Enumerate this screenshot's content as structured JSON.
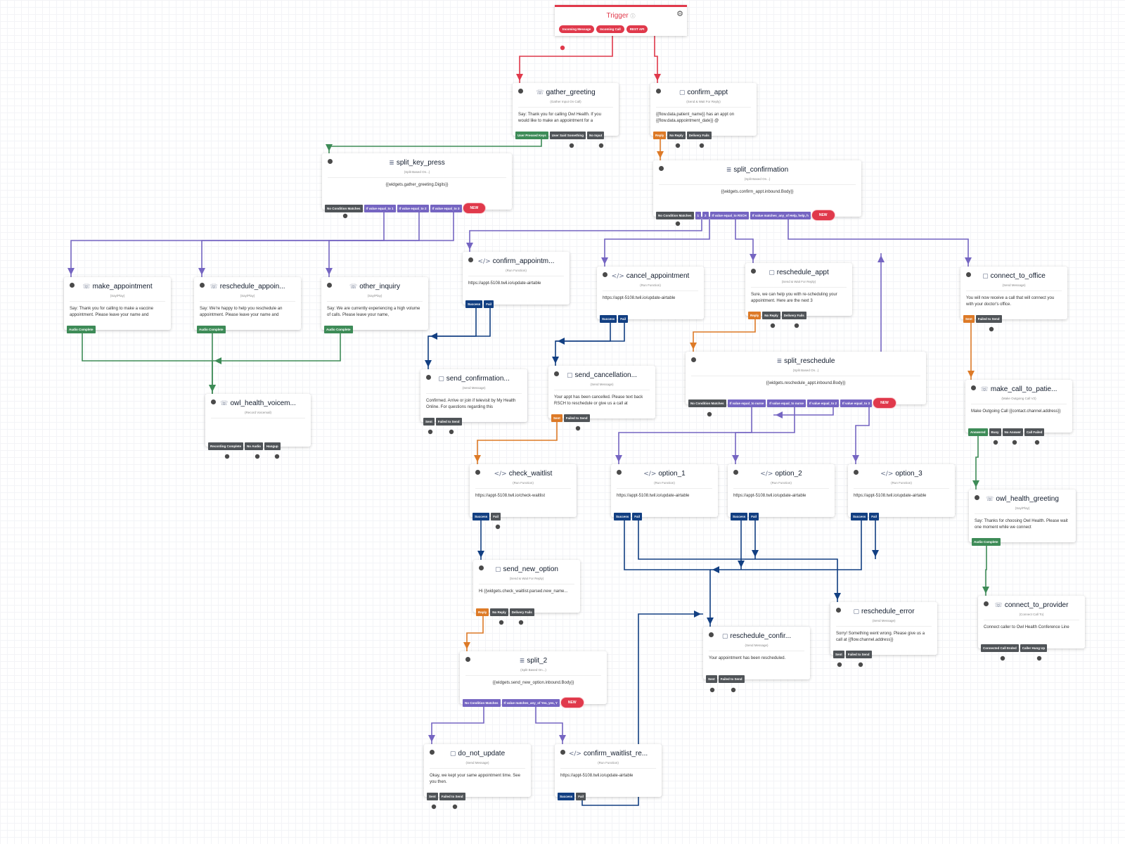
{
  "trigger": {
    "title": "Trigger",
    "help_icon": "help-circle-icon",
    "settings_icon": "gear-icon",
    "ports": [
      "Incoming Message",
      "Incoming Call",
      "REST API"
    ]
  },
  "colors": {
    "trigger_red": "#e0394b",
    "green": "#3d8b57",
    "orange": "#dd7a27",
    "purple": "#7565c2",
    "navy": "#123f82",
    "gray": "#505458"
  },
  "widgets": {
    "gather_greeting": {
      "name": "gather_greeting",
      "type": "(Gather Input On Call)",
      "icon": "phone-icon",
      "body": "Say: Thank you for calling Owl Health. If you would like to make an appointment for a",
      "ports": [
        "User Pressed Keys",
        "User Said Something",
        "No Input"
      ]
    },
    "confirm_appt": {
      "name": "confirm_appt",
      "type": "(Send & Wait For Reply)",
      "icon": "message-icon",
      "body": "{{flow.data.patient_name}} has an appt on {{flow.data.appointment_date}} @",
      "ports": [
        "Reply",
        "No Reply",
        "Delivery Fails"
      ]
    },
    "split_key_press": {
      "name": "split_key_press",
      "type": "(Split Based On...)",
      "icon": "split-icon",
      "body": "{{widgets.gather_greeting.Digits}}",
      "ports": [
        "No Condition Matches",
        "If value equal_to 1",
        "If value equal_to 2",
        "If value equal_to 3",
        "NEW"
      ]
    },
    "split_confirmation": {
      "name": "split_confirmation",
      "type": "(Split Based On...)",
      "icon": "split-icon",
      "body": "{{widgets.confirm_appt.inbound.Body}}",
      "ports": [
        "No Condition Matches",
        "1",
        "2",
        "If value equal_to RSCH",
        "If value matches_any_of Help, help, h",
        "NEW"
      ]
    },
    "make_appointment": {
      "name": "make_appointment",
      "type": "(Say/Play)",
      "icon": "phone-icon",
      "body": "Say: Thank you for calling to make a vaccine appointment. Please leave your name and",
      "ports": [
        "Audio Complete"
      ]
    },
    "reschedule_appoin": {
      "name": "reschedule_appoin...",
      "type": "(Say/Play)",
      "icon": "phone-icon",
      "body": "Say: We're happy to help you reschedule an appointment. Please leave your name and",
      "ports": [
        "Audio Complete"
      ]
    },
    "other_inquiry": {
      "name": "other_inquiry",
      "type": "(Say/Play)",
      "icon": "phone-icon",
      "body": "Say: We are currently experiencing a high volume of calls. Please leave your name,",
      "ports": [
        "Audio Complete"
      ]
    },
    "confirm_appointm": {
      "name": "confirm_appointm...",
      "type": "(Run Function)",
      "icon": "code-icon",
      "body": "https://appt-5108.twil.io/update-airtable",
      "ports": [
        "Success",
        "Fail"
      ]
    },
    "cancel_appointment": {
      "name": "cancel_appointment",
      "type": "(Run Function)",
      "icon": "code-icon",
      "body": "https://appt-5108.twil.io/update-airtable",
      "ports": [
        "Success",
        "Fail"
      ]
    },
    "reschedule_appt": {
      "name": "reschedule_appt",
      "type": "(Send & Wait For Reply)",
      "icon": "message-icon",
      "body": "Sure, we can help you with re-scheduling your appointment. Here are the next 3",
      "ports": [
        "Reply",
        "No Reply",
        "Delivery Fails"
      ]
    },
    "connect_to_office": {
      "name": "connect_to_office",
      "type": "(Send Message)",
      "icon": "message-icon",
      "body": "You will now receive a call that will connect you with your doctor's office.",
      "ports": [
        "Sent",
        "Failed to Send"
      ]
    },
    "owl_health_voicem": {
      "name": "owl_health_voicem...",
      "type": "(Record Voicemail)",
      "icon": "phone-icon",
      "body": "",
      "ports": [
        "Recording Complete",
        "No Audio",
        "Hangup"
      ]
    },
    "send_confirmation": {
      "name": "send_confirmation...",
      "type": "(Send Message)",
      "icon": "message-icon",
      "body": "Confirmed. Arrive or join if televisit by My Health Online. For questions regarding this",
      "ports": [
        "Sent",
        "Failed to Send"
      ]
    },
    "send_cancellation": {
      "name": "send_cancellation...",
      "type": "(Send Message)",
      "icon": "message-icon",
      "body": "Your appt has been cancelled. Please text back RSCH to reschedule or give us a call at",
      "ports": [
        "Sent",
        "Failed to Send"
      ]
    },
    "split_reschedule": {
      "name": "split_reschedule",
      "type": "(Split Based On...)",
      "icon": "split-icon",
      "body": "{{widgets.reschedule_appt.inbound.Body}}",
      "ports": [
        "No Condition Matches",
        "If value equal_to nurse",
        "If value equal_to nurse",
        "If value equal_to 2",
        "If value equal_to 3",
        "NEW"
      ]
    },
    "make_call_to_patie": {
      "name": "make_call_to_patie...",
      "type": "(Make Outgoing Call V2)",
      "icon": "phone-icon",
      "body": "Make Outgoing Call {{contact.channel.address}}",
      "ports": [
        "Answered",
        "Busy",
        "No Answer",
        "Call Failed"
      ]
    },
    "check_waitlist": {
      "name": "check_waitlist",
      "type": "(Run Function)",
      "icon": "code-icon",
      "body": "https://appt-5108.twil.io/check-waitlist",
      "ports": [
        "Success",
        "Fail"
      ]
    },
    "option_1": {
      "name": "option_1",
      "type": "(Run Function)",
      "icon": "code-icon",
      "body": "https://appt-5108.twil.io/update-airtable",
      "ports": [
        "Success",
        "Fail"
      ]
    },
    "option_2": {
      "name": "option_2",
      "type": "(Run Function)",
      "icon": "code-icon",
      "body": "https://appt-5108.twil.io/update-airtable",
      "ports": [
        "Success",
        "Fail"
      ]
    },
    "option_3": {
      "name": "option_3",
      "type": "(Run Function)",
      "icon": "code-icon",
      "body": "https://appt-5108.twil.io/update-airtable",
      "ports": [
        "Success",
        "Fail"
      ]
    },
    "owl_health_greeting": {
      "name": "owl_health_greeting",
      "type": "(Say/Play)",
      "icon": "phone-icon",
      "body": "Say: Thanks for choosing Owl Health. Please wait one moment while we connect",
      "ports": [
        "Audio Complete"
      ]
    },
    "send_new_option": {
      "name": "send_new_option",
      "type": "(Send & Wait For Reply)",
      "icon": "message-icon",
      "body": "Hi {{widgets.check_waitlist.parsed.new_name...",
      "ports": [
        "Reply",
        "No Reply",
        "Delivery Fails"
      ]
    },
    "connect_to_provider": {
      "name": "connect_to_provider",
      "type": "(Connect Call To)",
      "icon": "phone-icon",
      "body": "Connect caller to Owl Health Conference Line",
      "ports": [
        "Connected Call Ended",
        "Caller Hung Up"
      ]
    },
    "reschedule_error": {
      "name": "reschedule_error",
      "type": "(Send Message)",
      "icon": "message-icon",
      "body": "Sorry! Something went wrong. Please give us a call at {{flow.channel.address}}",
      "ports": [
        "Sent",
        "Failed to Send"
      ]
    },
    "reschedule_confir": {
      "name": "reschedule_confir...",
      "type": "(Send Message)",
      "icon": "message-icon",
      "body": "Your appointment has been rescheduled.",
      "ports": [
        "Sent",
        "Failed to Send"
      ]
    },
    "split_2": {
      "name": "split_2",
      "type": "(Split Based On...)",
      "icon": "split-icon",
      "body": "{{widgets.send_new_option.inbound.Body}}",
      "ports": [
        "No Condition Matches",
        "If value matches_any_of Yes, yes, Y",
        "NEW"
      ]
    },
    "do_not_update": {
      "name": "do_not_update",
      "type": "(Send Message)",
      "icon": "message-icon",
      "body": "Okay, we kept your same appointment time. See you then.",
      "ports": [
        "Sent",
        "Failed to Send"
      ]
    },
    "confirm_waitlist_re": {
      "name": "confirm_waitlist_re...",
      "type": "(Run Function)",
      "icon": "code-icon",
      "body": "https://appt-5108.twil.io/update-airtable",
      "ports": [
        "Success",
        "Fail"
      ]
    }
  }
}
